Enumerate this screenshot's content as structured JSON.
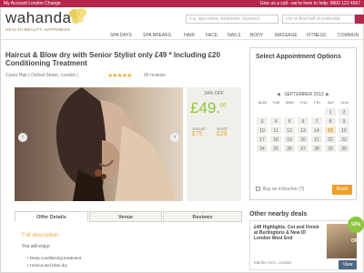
{
  "topbar": {
    "left": "My Account   London  Change",
    "right": "Give us a call - we're here to help: 0800 123 4567"
  },
  "header": {
    "logo": "wahanda",
    "tagline": "HEALTH·BEAUTY·HAPPINESS",
    "search_placeholder": "e.g. spa name, treatment, keyword",
    "location_placeholder": "city or first half of postcode"
  },
  "nav": {
    "items": [
      "SPA DAYS",
      "SPA BREAKS",
      "HAIR",
      "FACE",
      "NAILS",
      "BODY",
      "MASSAGE",
      "FITNESS",
      "COMMUN"
    ]
  },
  "deal": {
    "title": "Haircut & Blow dry with Senior Stylist only £49 * Including £20 Conditioning Treatment",
    "merchant": "Czaro Hair | Oxford Street, London |",
    "reviews": "90 reviews",
    "rating": 5,
    "discount": "34% OFF",
    "price": "£49.",
    "price_decimal": "00",
    "value_label": "VALUE:",
    "save_label": "SAVE:",
    "value_amt": "£75",
    "save_amt": "£26"
  },
  "tabs": [
    "Offer Details",
    "Venue",
    "Reviews"
  ],
  "description": {
    "heading": "Full description",
    "intro": "You will enjoy:",
    "bullets": [
      "Deep conditioning treatment",
      "Haircut and blow dry"
    ]
  },
  "appointment": {
    "title": "Select Appointment Options",
    "month": "SEPTEMBER 2012",
    "days": [
      "MON",
      "TUE",
      "WED",
      "THU",
      "FRI",
      "SAT",
      "SUN"
    ],
    "weeks": [
      [
        "",
        "",
        "",
        "",
        "",
        "1",
        "2"
      ],
      [
        "3",
        "4",
        "5",
        "6",
        "7",
        "8",
        "9"
      ],
      [
        "10",
        "11",
        "12",
        "13",
        "14",
        "15",
        "16"
      ],
      [
        "17",
        "18",
        "19",
        "20",
        "21",
        "22",
        "23"
      ],
      [
        "24",
        "25",
        "26",
        "27",
        "28",
        "29",
        "30"
      ]
    ],
    "today": "15",
    "ewatcher": "Buy as eVoucher (?)",
    "book": "Book"
  },
  "nearby": {
    "title": "Other nearby deals",
    "text": "£49 Highlights, Cut and Finish at Burlingtons & New ID London West End",
    "location": "Marble Arch, London",
    "discount": "53% OFF",
    "view": "View"
  }
}
